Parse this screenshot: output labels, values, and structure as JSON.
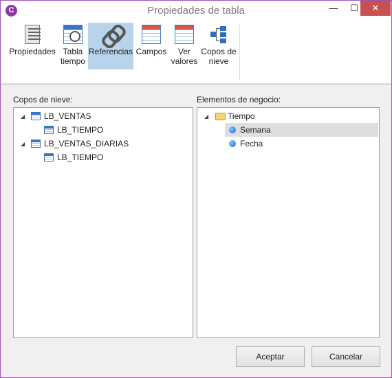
{
  "window": {
    "title": "Propiedades de tabla",
    "app_icon": "C",
    "min_glyph": "—",
    "max_glyph": "☐",
    "close_glyph": "✕"
  },
  "ribbon": {
    "items": [
      {
        "label_line1": "Propiedades",
        "label_line2": "",
        "icon": "properties-icon",
        "active": false
      },
      {
        "label_line1": "Tabla",
        "label_line2": "tiempo",
        "icon": "time-table-icon",
        "active": false
      },
      {
        "label_line1": "Referencias",
        "label_line2": "",
        "icon": "chain-link-icon",
        "active": true
      },
      {
        "label_line1": "Campos",
        "label_line2": "",
        "icon": "fields-grid-icon",
        "active": false
      },
      {
        "label_line1": "Ver",
        "label_line2": "valores",
        "icon": "values-grid-icon",
        "active": false
      },
      {
        "label_line1": "Copos de",
        "label_line2": "nieve",
        "icon": "snowflake-tree-icon",
        "active": false
      }
    ]
  },
  "left_panel": {
    "label": "Copos de nieve:",
    "nodes": [
      {
        "text": "LB_VENTAS",
        "level": 0,
        "expanded": true
      },
      {
        "text": "LB_TIEMPO",
        "level": 1
      },
      {
        "text": "LB_VENTAS_DIARIAS",
        "level": 0,
        "expanded": true
      },
      {
        "text": "LB_TIEMPO",
        "level": 1
      }
    ]
  },
  "right_panel": {
    "label": "Elementos de negocio:",
    "nodes": [
      {
        "text": "Tiempo",
        "level": 0,
        "expanded": true,
        "icon": "folder-icon"
      },
      {
        "text": "Semana",
        "level": 1,
        "icon": "blue-dot-icon",
        "selected": true
      },
      {
        "text": "Fecha",
        "level": 1,
        "icon": "blue-dot-icon"
      }
    ]
  },
  "buttons": {
    "accept": "Aceptar",
    "cancel": "Cancelar"
  },
  "colors": {
    "accent_border": "#a052b5",
    "ribbon_active": "#b8d4ec",
    "close_button": "#c75050"
  }
}
